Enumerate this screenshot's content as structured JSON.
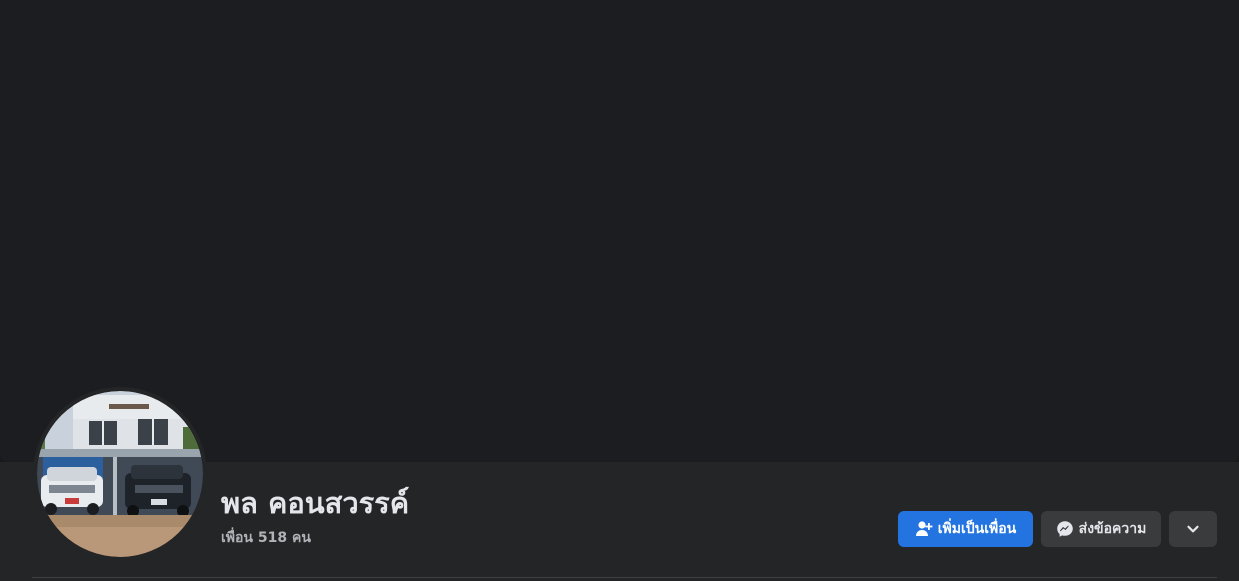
{
  "profile": {
    "name": "พล คอนสวรรค์",
    "friends_text": "เพื่อน 518 คน",
    "avatar_alt": "รูปโปรไฟล์"
  },
  "actions": {
    "add_friend_label": "เพิ่มเป็นเพื่อน",
    "add_friend_icon": "add-friend-icon",
    "message_label": "ส่งข้อความ",
    "message_icon": "messenger-icon",
    "more_icon": "chevron-down-icon"
  },
  "colors": {
    "page_bg": "#18191a",
    "cover_bg": "#1c1d20",
    "bar_bg": "#242526",
    "primary_button": "#2374e1",
    "secondary_button": "#3a3b3c",
    "text_primary": "#e4e6eb",
    "text_secondary": "#b0b3b8"
  }
}
